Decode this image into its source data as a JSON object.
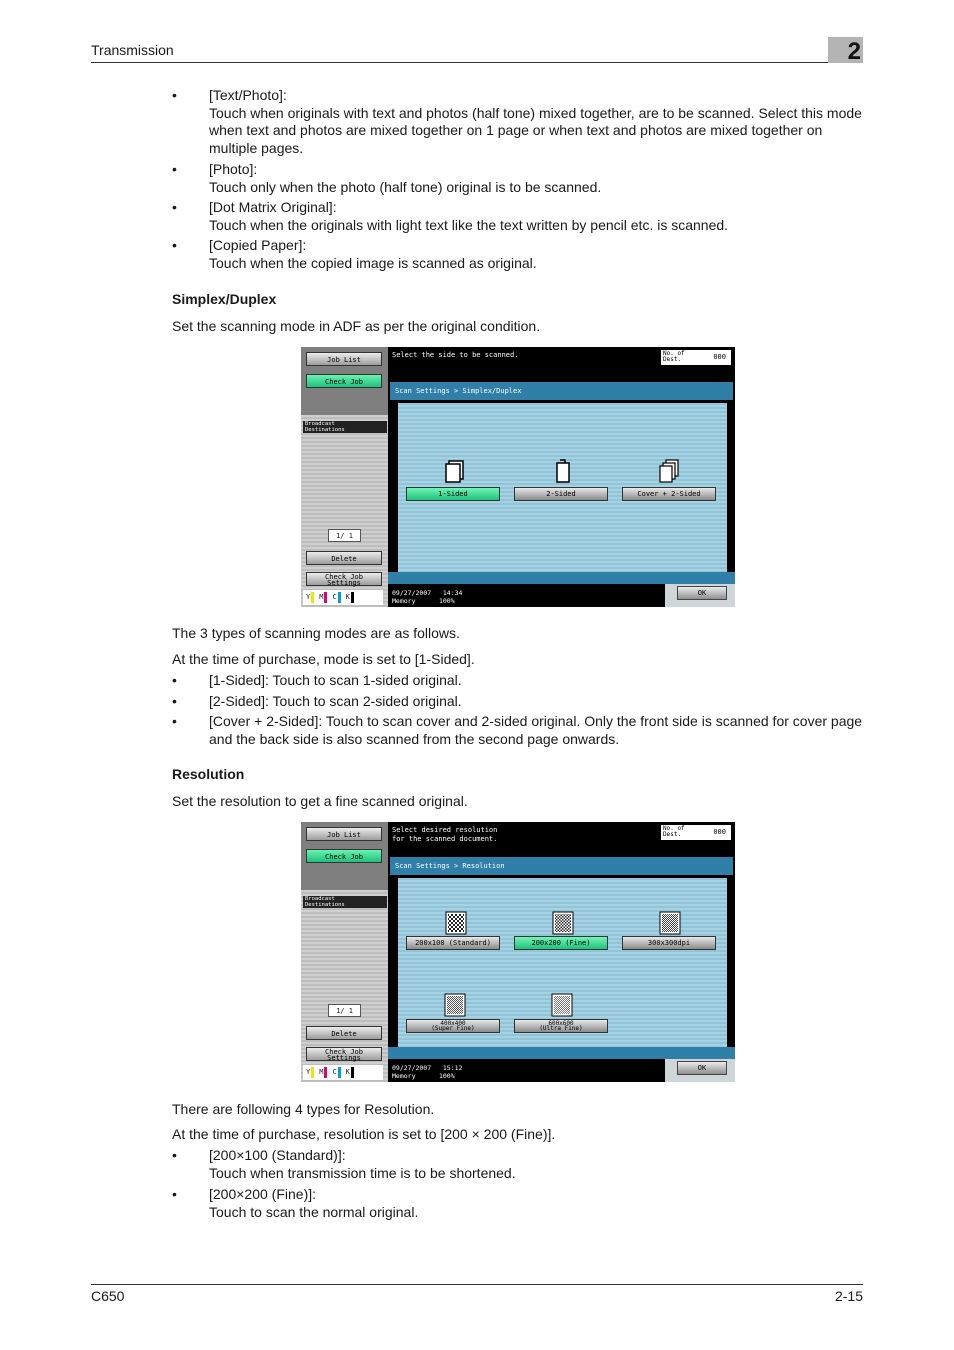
{
  "header": {
    "title": "Transmission",
    "chapter": "2"
  },
  "footer": {
    "model": "C650",
    "page": "2-15"
  },
  "intro_bullets": [
    {
      "label": "[Text/Photo]:",
      "text": "Touch when originals with text and photos (half tone) mixed together, are to be scanned. Select this mode when text and photos are mixed together on 1 page or when text and photos are mixed together on multiple pages."
    },
    {
      "label": "[Photo]:",
      "text": "Touch only when the photo (half tone) original is to be scanned."
    },
    {
      "label": "[Dot Matrix Original]:",
      "text": "Touch when the originals with light text like the text written by pencil etc. is scanned."
    },
    {
      "label": "[Copied Paper]:",
      "text": "Touch when the copied image is scanned as original."
    }
  ],
  "simplex": {
    "heading": "Simplex/Duplex",
    "desc": "Set the scanning mode in ADF as per the original condition.",
    "after1": "The 3 types of scanning modes are as follows.",
    "after2": "At the time of purchase, mode is set to [1-Sided].",
    "bullets": [
      "[1-Sided]: Touch to scan 1-sided original.",
      "[2-Sided]: Touch to scan 2-sided original.",
      "[Cover + 2-Sided]: Touch to scan cover and 2-sided original. Only the front side is scanned for cover page and the back side is also scanned from the second page onwards."
    ]
  },
  "screen1": {
    "message": "Select the side to be scanned.",
    "breadcrumb": "Scan Settings > Simplex/Duplex",
    "options": [
      "1-Sided",
      "2-Sided",
      "Cover + 2-Sided"
    ],
    "status_date": "09/27/2007",
    "status_time": "14:34",
    "status_memory_label": "Memory",
    "status_memory": "100%"
  },
  "resolution": {
    "heading": "Resolution",
    "desc": "Set the resolution to get a fine scanned original.",
    "after1": "There are following 4 types for Resolution.",
    "after2": "At the time of purchase, resolution is set to [200 × 200 (Fine)].",
    "bullets": [
      {
        "label": "[200×100 (Standard)]:",
        "text": "Touch when transmission time is to be shortened."
      },
      {
        "label": "[200×200 (Fine)]:",
        "text": "Touch to scan the normal original."
      }
    ]
  },
  "screen2": {
    "message_l1": "Select desired resolution",
    "message_l2": "for the scanned document.",
    "breadcrumb": "Scan Settings > Resolution",
    "options_row1": [
      "200x100 (Standard)",
      "200x200 (Fine)",
      "300x300dpi"
    ],
    "options_row2_l1": [
      "400x400",
      "600x600"
    ],
    "options_row2_l2": [
      "(Super Fine)",
      "(Ultra Fine)"
    ],
    "status_date": "09/27/2007",
    "status_time": "15:12",
    "status_memory_label": "Memory",
    "status_memory": "100%"
  },
  "device_common": {
    "job_list": "Job List",
    "check_job": "Check Job",
    "broadcast_l1": "Broadcast",
    "broadcast_l2": "Destinations",
    "counter": "1/  1",
    "delete": "Delete",
    "check_job_settings_l1": "Check Job",
    "check_job_settings_l2": "Settings",
    "no_of_l1": "No. of",
    "no_of_l2": "Dest.",
    "dest_count": "000",
    "ok": "OK",
    "toner": [
      "Y",
      "M",
      "C",
      "K"
    ],
    "toner_colors": [
      "#f2e600",
      "#e0007a",
      "#00a0e0",
      "#000000"
    ]
  }
}
